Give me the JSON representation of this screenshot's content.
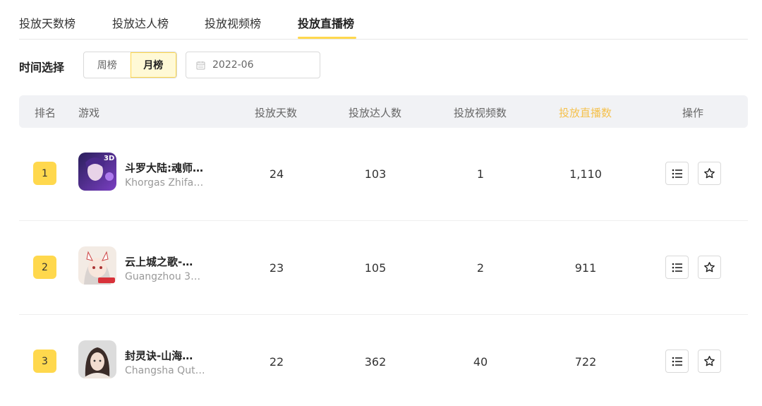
{
  "tabs": [
    {
      "label": "投放天数榜",
      "active": false
    },
    {
      "label": "投放达人榜",
      "active": false
    },
    {
      "label": "投放视频榜",
      "active": false
    },
    {
      "label": "投放直播榜",
      "active": true
    }
  ],
  "filter": {
    "label": "时间选择",
    "period_options": [
      "周榜",
      "月榜"
    ],
    "selected_period": "月榜",
    "date_value": "2022-06",
    "date_icon": "calendar-icon"
  },
  "table": {
    "headers": [
      "排名",
      "游戏",
      "投放天数",
      "投放达人数",
      "投放视频数",
      "投放直播数",
      "操作"
    ],
    "highlight_header": "投放直播数",
    "rows": [
      {
        "rank": "1",
        "name": "斗罗大陆:魂师…",
        "company": "Khorgas Zhifa…",
        "days": "24",
        "influencers": "103",
        "videos": "1",
        "lives": "1,110"
      },
      {
        "rank": "2",
        "name": "云上城之歌-…",
        "company": "Guangzhou 37…",
        "days": "23",
        "influencers": "105",
        "videos": "2",
        "lives": "911"
      },
      {
        "rank": "3",
        "name": "封灵诀-山海…",
        "company": "Changsha Qut…",
        "days": "22",
        "influencers": "362",
        "videos": "40",
        "lives": "722"
      }
    ],
    "action_icons": [
      "list-icon",
      "star-icon"
    ]
  },
  "colors": {
    "accent": "#ffd84d",
    "highlight_text": "#f5c14d",
    "header_bg": "#f1f2f5"
  }
}
